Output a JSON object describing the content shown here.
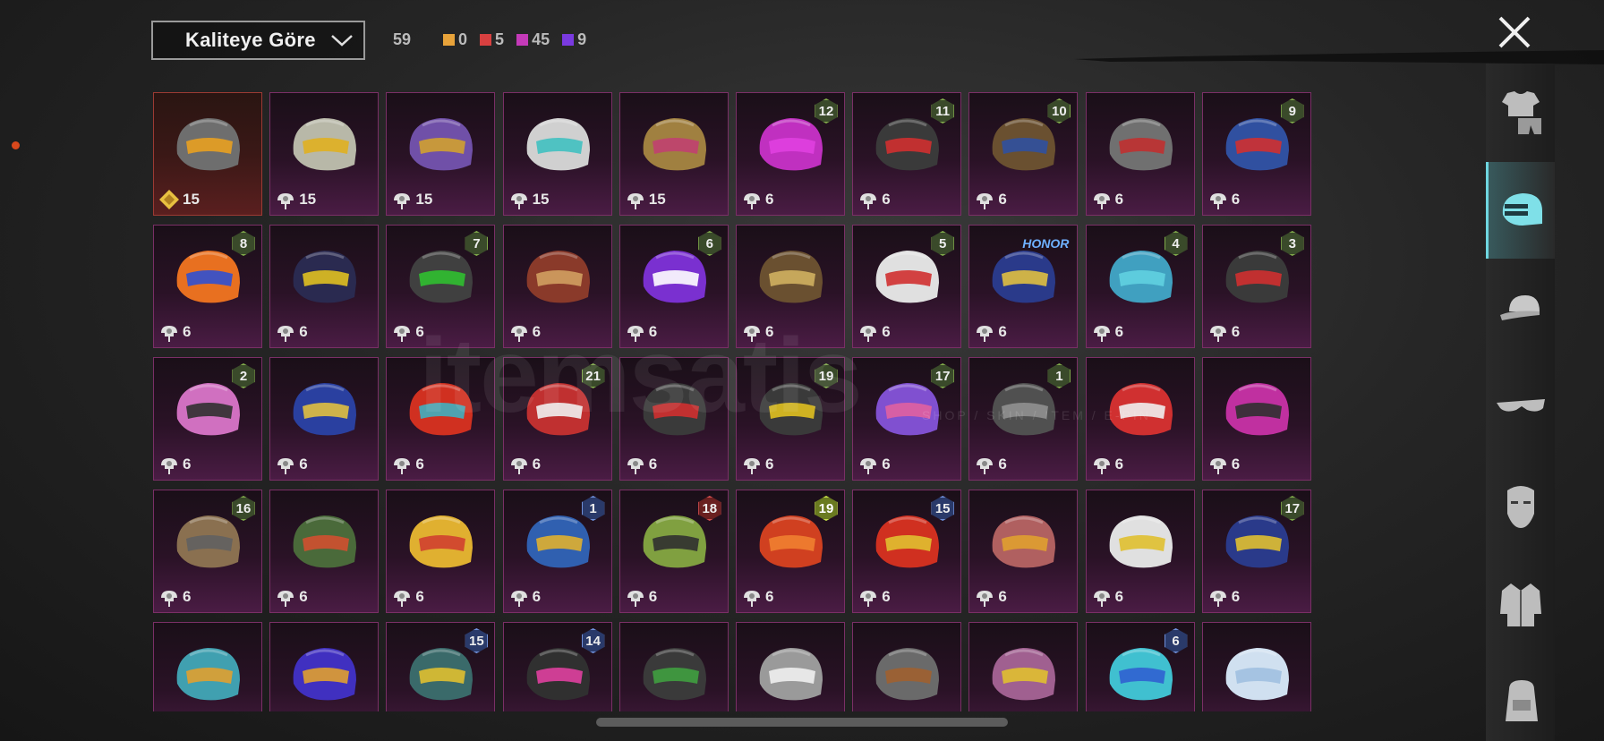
{
  "sort": {
    "label": "Kaliteye Göre"
  },
  "counts": {
    "total": "59",
    "items": [
      {
        "value": "0",
        "color": "#e8a33a"
      },
      {
        "value": "5",
        "color": "#d84040"
      },
      {
        "value": "45",
        "color": "#c43ab8"
      },
      {
        "value": "9",
        "color": "#7a3ae0"
      }
    ]
  },
  "side_nav": [
    {
      "name": "outfit-icon",
      "active": false
    },
    {
      "name": "helmet-icon",
      "active": true
    },
    {
      "name": "cap-icon",
      "active": false
    },
    {
      "name": "glasses-icon",
      "active": false
    },
    {
      "name": "face-icon",
      "active": false
    },
    {
      "name": "jacket-icon",
      "active": false
    },
    {
      "name": "backpack-icon",
      "active": false
    }
  ],
  "watermark": {
    "text": "itemsatis",
    "sub": "SHOP / SKIN / ITEM / E-PIN"
  },
  "rows": [
    [
      {
        "cost": "15",
        "badge": "",
        "tier": "gold",
        "color": "#6e6e6e",
        "accent": "#e8a020"
      },
      {
        "cost": "15",
        "badge": "",
        "tier": "red",
        "color": "#b8b8a8",
        "accent": "#e0b020"
      },
      {
        "cost": "15",
        "badge": "",
        "tier": "red",
        "color": "#7050a8",
        "accent": "#d0a030"
      },
      {
        "cost": "15",
        "badge": "",
        "tier": "red",
        "color": "#d0d0d0",
        "accent": "#40c0c0"
      },
      {
        "cost": "15",
        "badge": "",
        "tier": "red",
        "color": "#a08040",
        "accent": "#c04070"
      },
      {
        "cost": "6",
        "badge": "12",
        "tier": "purple",
        "color": "#c030c0",
        "accent": "#e040e0"
      },
      {
        "cost": "6",
        "badge": "11",
        "tier": "purple",
        "color": "#3a3a3a",
        "accent": "#d03030"
      },
      {
        "cost": "6",
        "badge": "10",
        "tier": "purple",
        "color": "#6a5030",
        "accent": "#3050a0"
      },
      {
        "cost": "6",
        "badge": "",
        "tier": "purple",
        "color": "#707070",
        "accent": "#c03030"
      },
      {
        "cost": "6",
        "badge": "9",
        "tier": "purple",
        "color": "#3050a0",
        "accent": "#d03030"
      }
    ],
    [
      {
        "cost": "6",
        "badge": "8",
        "tier": "purple",
        "color": "#e87020",
        "accent": "#3050d0"
      },
      {
        "cost": "6",
        "badge": "",
        "tier": "purple",
        "color": "#2a2a50",
        "accent": "#e0c020"
      },
      {
        "cost": "6",
        "badge": "7",
        "tier": "purple",
        "color": "#404040",
        "accent": "#30c030"
      },
      {
        "cost": "6",
        "badge": "",
        "tier": "purple",
        "color": "#8a3a2a",
        "accent": "#d0a060"
      },
      {
        "cost": "6",
        "badge": "6",
        "tier": "purple",
        "color": "#7a30d0",
        "accent": "#ffffff"
      },
      {
        "cost": "6",
        "badge": "",
        "tier": "purple",
        "color": "#6a5030",
        "accent": "#d0b060"
      },
      {
        "cost": "6",
        "badge": "5",
        "tier": "purple",
        "color": "#e0e0e0",
        "accent": "#d03030"
      },
      {
        "cost": "6",
        "badge": "HONOR",
        "tier": "purple",
        "color": "#2a3a8a",
        "accent": "#e0c040"
      },
      {
        "cost": "6",
        "badge": "4",
        "tier": "purple",
        "color": "#40a0c0",
        "accent": "#60d0e0"
      },
      {
        "cost": "6",
        "badge": "3",
        "tier": "purple",
        "color": "#3a3a3a",
        "accent": "#d03030"
      }
    ],
    [
      {
        "cost": "6",
        "badge": "2",
        "tier": "purple",
        "color": "#d070c0",
        "accent": "#303030"
      },
      {
        "cost": "6",
        "badge": "",
        "tier": "purple",
        "color": "#2a40a0",
        "accent": "#e0c040"
      },
      {
        "cost": "6",
        "badge": "",
        "tier": "purple",
        "color": "#d03020",
        "accent": "#40b0c0"
      },
      {
        "cost": "6",
        "badge": "21",
        "tier": "purple",
        "color": "#c03030",
        "accent": "#f0f0f0"
      },
      {
        "cost": "6",
        "badge": "",
        "tier": "purple",
        "color": "#3a3a3a",
        "accent": "#d03030"
      },
      {
        "cost": "6",
        "badge": "19",
        "tier": "purple",
        "color": "#3a3a3a",
        "accent": "#e0c020"
      },
      {
        "cost": "6",
        "badge": "17",
        "tier": "purple",
        "color": "#8050d0",
        "accent": "#e060a0"
      },
      {
        "cost": "6",
        "badge": "1",
        "tier": "purple",
        "color": "#505050",
        "accent": "#909090"
      },
      {
        "cost": "6",
        "badge": "",
        "tier": "purple",
        "color": "#d03030",
        "accent": "#f0f0f0"
      },
      {
        "cost": "6",
        "badge": "",
        "tier": "purple",
        "color": "#c030a0",
        "accent": "#303030"
      }
    ],
    [
      {
        "cost": "6",
        "badge": "16",
        "tier": "purple",
        "color": "#8a7050",
        "accent": "#606060"
      },
      {
        "cost": "6",
        "badge": "",
        "tier": "purple",
        "color": "#4a6a3a",
        "accent": "#d05030"
      },
      {
        "cost": "6",
        "badge": "",
        "tier": "purple",
        "color": "#e0b030",
        "accent": "#d04030"
      },
      {
        "cost": "6",
        "badge": "1",
        "tier": "purple",
        "color": "#3060b0",
        "accent": "#e0b030"
      },
      {
        "cost": "6",
        "badge": "18",
        "tier": "purple",
        "color": "#80a040",
        "accent": "#303030"
      },
      {
        "cost": "6",
        "badge": "19",
        "tier": "purple",
        "color": "#d04020",
        "accent": "#f08030"
      },
      {
        "cost": "6",
        "badge": "15",
        "tier": "purple",
        "color": "#d03020",
        "accent": "#e0c030"
      },
      {
        "cost": "6",
        "badge": "",
        "tier": "purple",
        "color": "#b06060",
        "accent": "#e0a030"
      },
      {
        "cost": "6",
        "badge": "",
        "tier": "purple",
        "color": "#e0e0e0",
        "accent": "#e0c030"
      },
      {
        "cost": "6",
        "badge": "17",
        "tier": "purple",
        "color": "#2a3a8a",
        "accent": "#e0c030"
      }
    ],
    [
      {
        "cost": "",
        "badge": "",
        "tier": "purple",
        "color": "#40a0b0",
        "accent": "#e0a030"
      },
      {
        "cost": "",
        "badge": "",
        "tier": "purple",
        "color": "#4030c0",
        "accent": "#e0a030"
      },
      {
        "cost": "",
        "badge": "15",
        "tier": "purple",
        "color": "#3a6a6a",
        "accent": "#e0c030"
      },
      {
        "cost": "",
        "badge": "14",
        "tier": "purple",
        "color": "#303030",
        "accent": "#e040a0"
      },
      {
        "cost": "",
        "badge": "",
        "tier": "purple",
        "color": "#3a3a3a",
        "accent": "#40a040"
      },
      {
        "cost": "",
        "badge": "",
        "tier": "purple",
        "color": "#9a9a9a",
        "accent": "#f0f0f0"
      },
      {
        "cost": "",
        "badge": "",
        "tier": "purple",
        "color": "#6a6a6a",
        "accent": "#a06030"
      },
      {
        "cost": "",
        "badge": "",
        "tier": "purple",
        "color": "#a06090",
        "accent": "#e0c030"
      },
      {
        "cost": "",
        "badge": "6",
        "tier": "purple",
        "color": "#40c0d0",
        "accent": "#3060d0"
      },
      {
        "cost": "",
        "badge": "",
        "tier": "purple",
        "color": "#d0e0f0",
        "accent": "#a0c0e0"
      }
    ]
  ]
}
